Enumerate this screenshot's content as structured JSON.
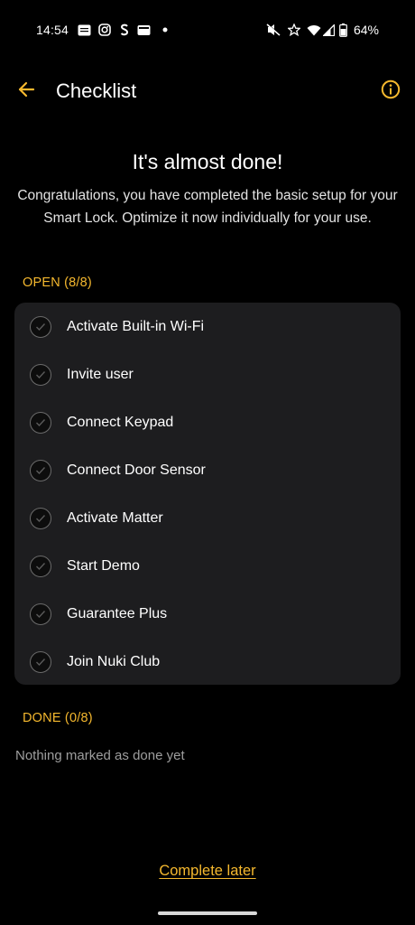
{
  "status_bar": {
    "time": "14:54",
    "battery": "64%",
    "icons": [
      "news-icon",
      "instagram-icon",
      "shazam-icon",
      "wallet-icon",
      "dot-icon",
      "mute-vibrate-icon",
      "star-icon",
      "wifi-icon",
      "signal-icon",
      "battery-icon"
    ]
  },
  "app_bar": {
    "title": "Checklist",
    "back_icon": "arrow-left-icon",
    "info_icon": "info-icon"
  },
  "headline": "It's almost done!",
  "description": "Congratulations, you have completed the basic setup for your Smart Lock. Optimize it now individually for your use.",
  "open_section": {
    "label": "OPEN (8/8)",
    "items": [
      {
        "label": "Activate Built-in Wi-Fi"
      },
      {
        "label": "Invite user"
      },
      {
        "label": "Connect Keypad"
      },
      {
        "label": "Connect Door Sensor"
      },
      {
        "label": "Activate Matter"
      },
      {
        "label": "Start Demo"
      },
      {
        "label": "Guarantee Plus"
      },
      {
        "label": "Join Nuki Club"
      }
    ]
  },
  "done_section": {
    "label": "DONE (0/8)",
    "empty_text": "Nothing marked as done yet"
  },
  "footer": {
    "complete_later": "Complete later"
  },
  "colors": {
    "accent": "#f5b82e",
    "background": "#000000",
    "card": "#1d1d1f"
  }
}
